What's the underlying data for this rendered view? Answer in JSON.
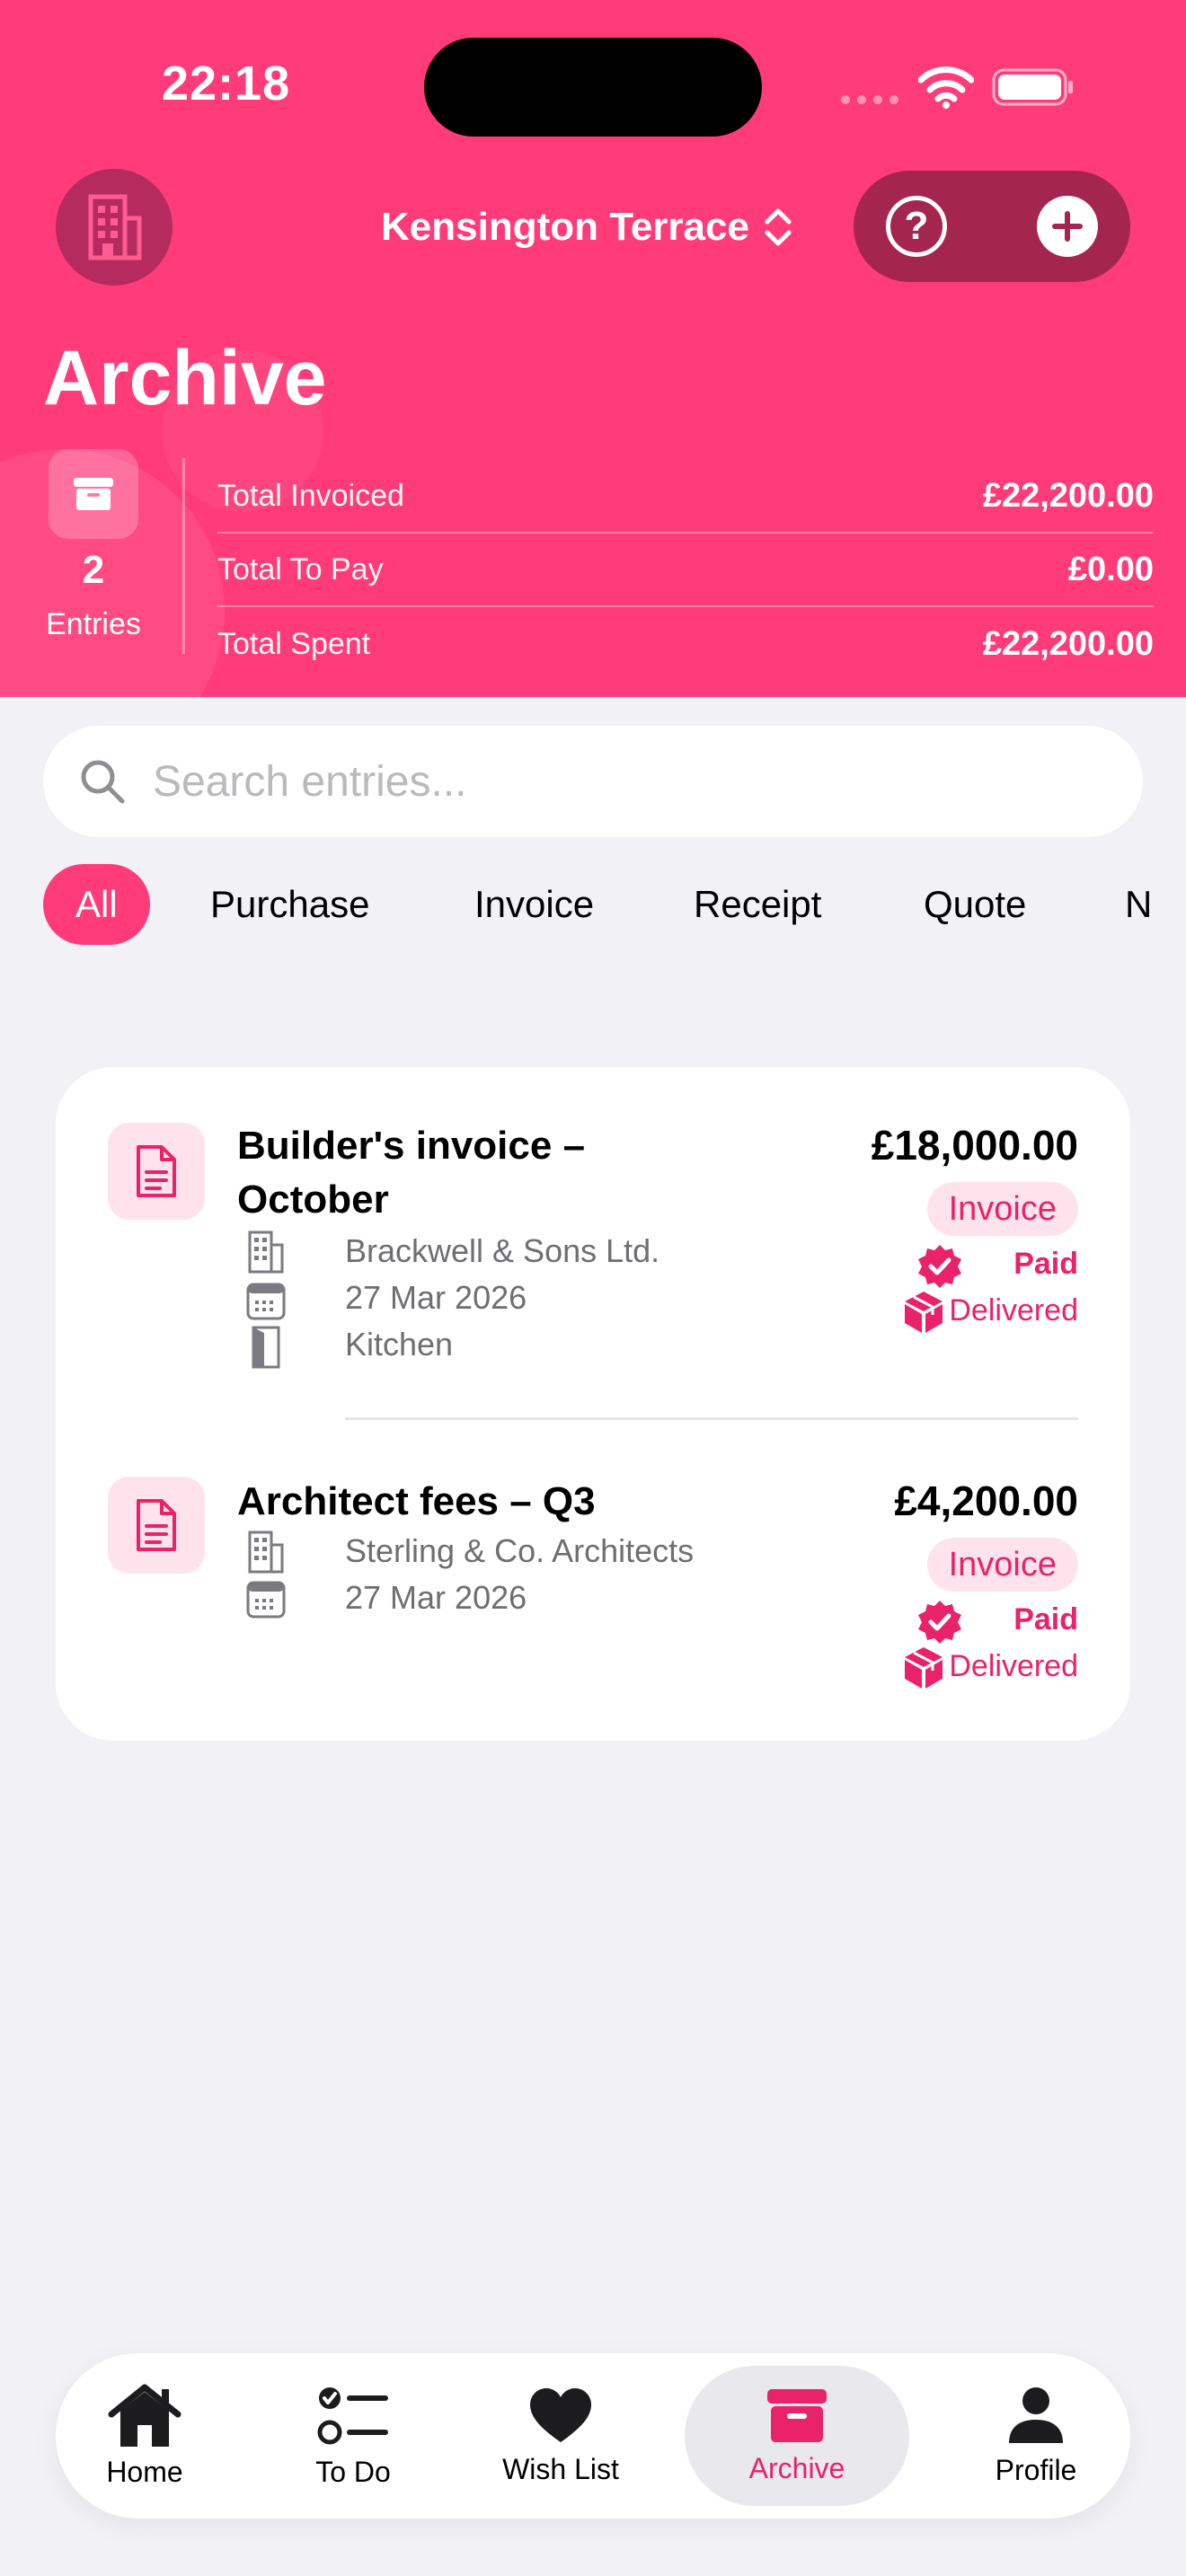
{
  "status_bar": {
    "time": "22:18"
  },
  "header": {
    "property_name": "Kensington Terrace",
    "help_label": "?",
    "title": "Archive"
  },
  "summary": {
    "entries_count": "2",
    "entries_label": "Entries",
    "rows": [
      {
        "label": "Total Invoiced",
        "value": "£22,200.00"
      },
      {
        "label": "Total To Pay",
        "value": "£0.00"
      },
      {
        "label": "Total Spent",
        "value": "£22,200.00"
      }
    ]
  },
  "search": {
    "placeholder": "Search entries..."
  },
  "filters": [
    "All",
    "Purchase",
    "Invoice",
    "Receipt",
    "Quote",
    "N"
  ],
  "entries": [
    {
      "title": "Builder's invoice – October",
      "supplier": "Brackwell & Sons Ltd.",
      "date": "27 Mar 2026",
      "room": "Kitchen",
      "amount": "£18,000.00",
      "type": "Invoice",
      "payment_status": "Paid",
      "delivery_status": "Delivered"
    },
    {
      "title": "Architect fees – Q3",
      "supplier": "Sterling & Co. Architects",
      "date": "27 Mar 2026",
      "amount": "£4,200.00",
      "type": "Invoice",
      "payment_status": "Paid",
      "delivery_status": "Delivered"
    }
  ],
  "tabbar": {
    "items": [
      {
        "label": "Home",
        "icon": "house-icon"
      },
      {
        "label": "To Do",
        "icon": "checklist-icon"
      },
      {
        "label": "Wish List",
        "icon": "heart-icon"
      },
      {
        "label": "Archive",
        "icon": "archive-box-icon"
      },
      {
        "label": "Profile",
        "icon": "person-icon"
      }
    ],
    "active": "Archive"
  },
  "colors": {
    "accent": "#FF3B7A",
    "accent_text": "#E9226A",
    "badge_bg": "#FFE3EC",
    "background": "#F2F1F6"
  }
}
